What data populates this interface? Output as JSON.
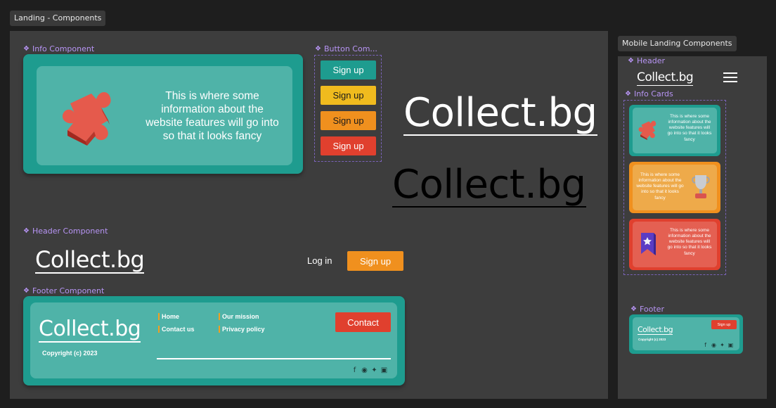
{
  "frames": {
    "landing_title": "Landing - Components",
    "mobile_title": "Mobile Landing Components"
  },
  "components": {
    "info": "Info Component",
    "button": "Button Com...",
    "header": "Header Component",
    "footer": "Footer Component",
    "m_header": "Header",
    "m_info_cards": "Info Cards",
    "m_footer": "Footer"
  },
  "brand": {
    "logo": "Collect.bg"
  },
  "info_card": {
    "text": "This is where some information about the website features will go into so that it looks fancy"
  },
  "buttons": [
    {
      "label": "Sign up",
      "color": "#1e9c8f"
    },
    {
      "label": "Sign up",
      "color": "#f0bb1e"
    },
    {
      "label": "Sign up",
      "color": "#f0901e"
    },
    {
      "label": "Sign up",
      "color": "#e0402e"
    }
  ],
  "header": {
    "login": "Log in",
    "signup": "Sign up"
  },
  "footer": {
    "links": [
      "Home",
      "Contact us",
      "Our mission",
      "Privacy policy"
    ],
    "contact": "Contact",
    "copyright": "Copyright (c) 2023"
  },
  "mobile": {
    "cards": [
      {
        "text": "This is where some information about the website features will go into so that it looks fancy",
        "color": "#1e9c8f",
        "inner": "#4fb3a8",
        "icon": "puzzle-icon"
      },
      {
        "text": "This is where some information about the website features will go into so that it looks fancy",
        "color": "#f0901e",
        "inner": "#eeaa4a",
        "icon": "trophy-icon"
      },
      {
        "text": "This is where some information about the website features will go into so that it looks fancy",
        "color": "#e0402e",
        "inner": "#e46052",
        "icon": "bookmark-icon"
      }
    ],
    "footer_signup": "Sign up",
    "footer_copyright": "Copyright (c) 2023"
  },
  "colors": {
    "teal": "#1e9c8f",
    "teal_light": "#4fb3a8",
    "yellow": "#f0bb1e",
    "orange": "#f0901e",
    "red": "#e0402e",
    "frame_bg": "#3d3d3d",
    "canvas_bg": "#1e1e1e",
    "component_label": "#b794f4"
  }
}
